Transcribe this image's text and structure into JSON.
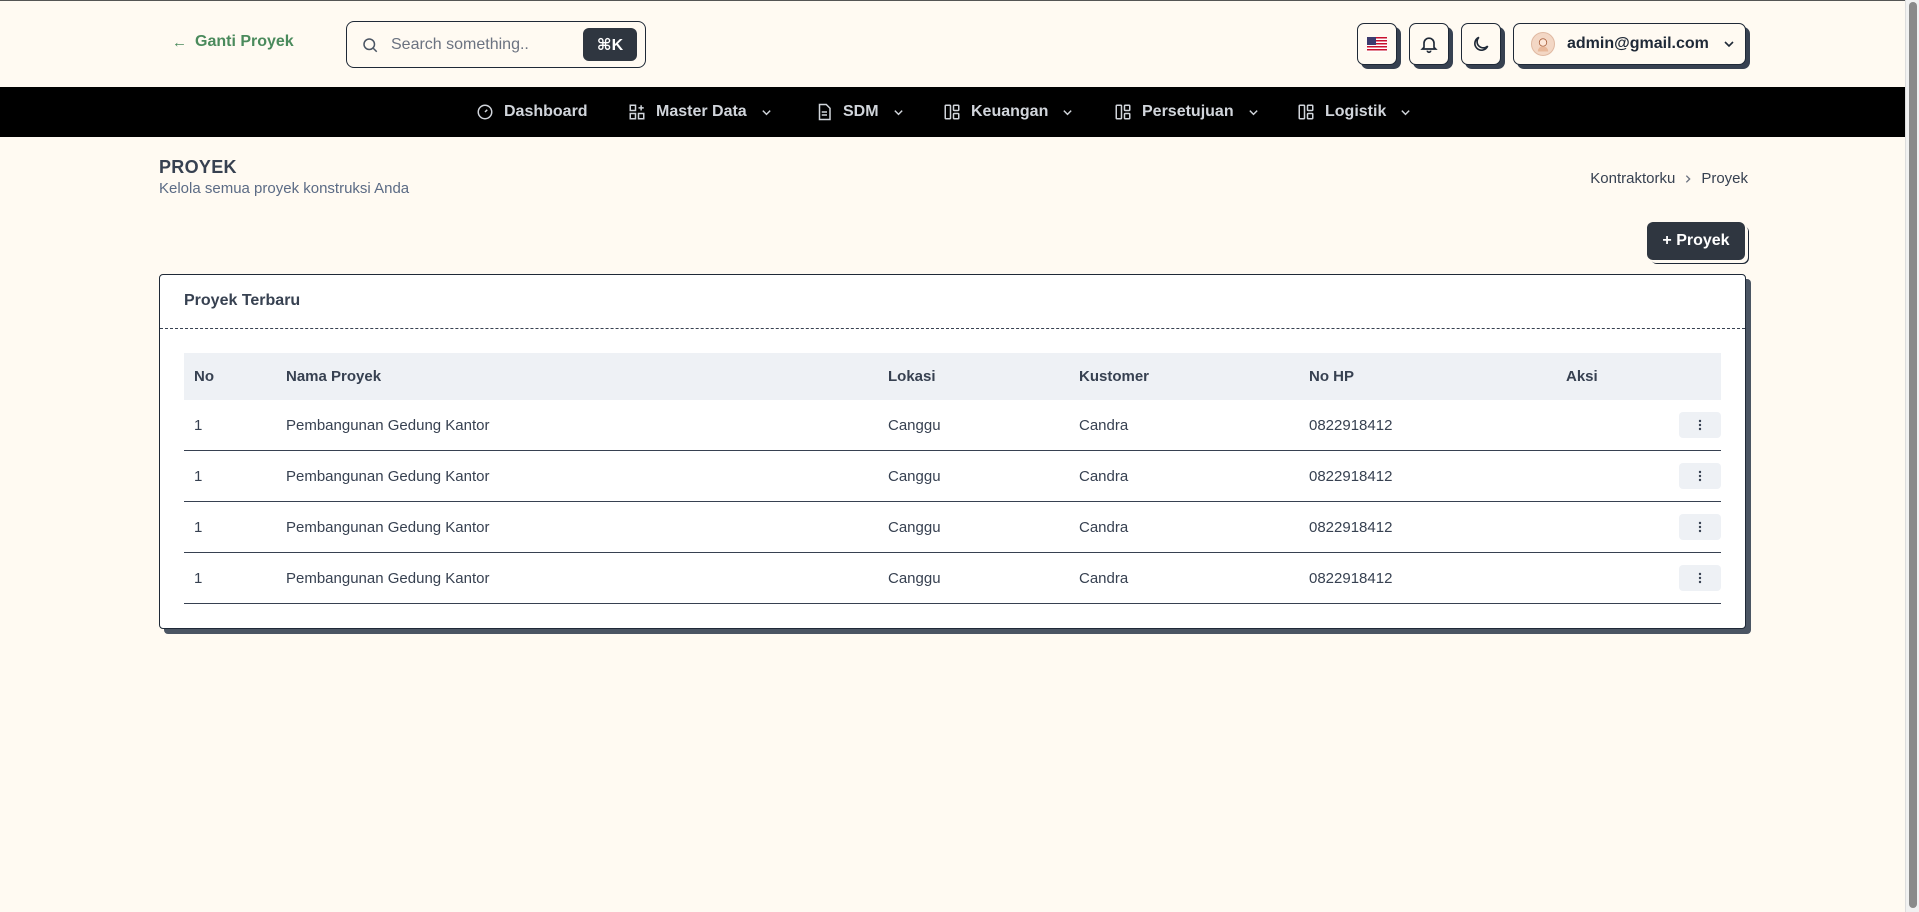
{
  "header": {
    "back_label": "Ganti Proyek",
    "search_placeholder": "Search something..",
    "search_shortcut": "⌘K",
    "user_email": "admin@gmail.com"
  },
  "nav": {
    "items": [
      {
        "label": "Dashboard",
        "icon": "gauge-icon",
        "has_dropdown": false
      },
      {
        "label": "Master Data",
        "icon": "grid-plus-icon",
        "has_dropdown": true
      },
      {
        "label": "SDM",
        "icon": "document-icon",
        "has_dropdown": true
      },
      {
        "label": "Keuangan",
        "icon": "layout-icon",
        "has_dropdown": true
      },
      {
        "label": "Persetujuan",
        "icon": "layout-icon",
        "has_dropdown": true
      },
      {
        "label": "Logistik",
        "icon": "layout-icon",
        "has_dropdown": true
      }
    ]
  },
  "page": {
    "title": "PROYEK",
    "subtitle": "Kelola semua proyek konstruksi Anda",
    "breadcrumb": [
      "Kontraktorku",
      "Proyek"
    ],
    "add_button": "+ Proyek"
  },
  "card": {
    "title": "Proyek Terbaru",
    "columns": [
      "No",
      "Nama Proyek",
      "Lokasi",
      "Kustomer",
      "No HP",
      "Aksi"
    ],
    "rows": [
      [
        "1",
        "Pembangunan Gedung Kantor",
        "Canggu",
        "Candra",
        "0822918412"
      ],
      [
        "1",
        "Pembangunan Gedung Kantor",
        "Canggu",
        "Candra",
        "0822918412"
      ],
      [
        "1",
        "Pembangunan Gedung Kantor",
        "Canggu",
        "Candra",
        "0822918412"
      ],
      [
        "1",
        "Pembangunan Gedung Kantor",
        "Canggu",
        "Candra",
        "0822918412"
      ]
    ]
  },
  "colors": {
    "background": "#fffaf2",
    "nav_bg": "#000000",
    "accent_green": "#4a8a5c",
    "button_dark": "#2f3640"
  }
}
